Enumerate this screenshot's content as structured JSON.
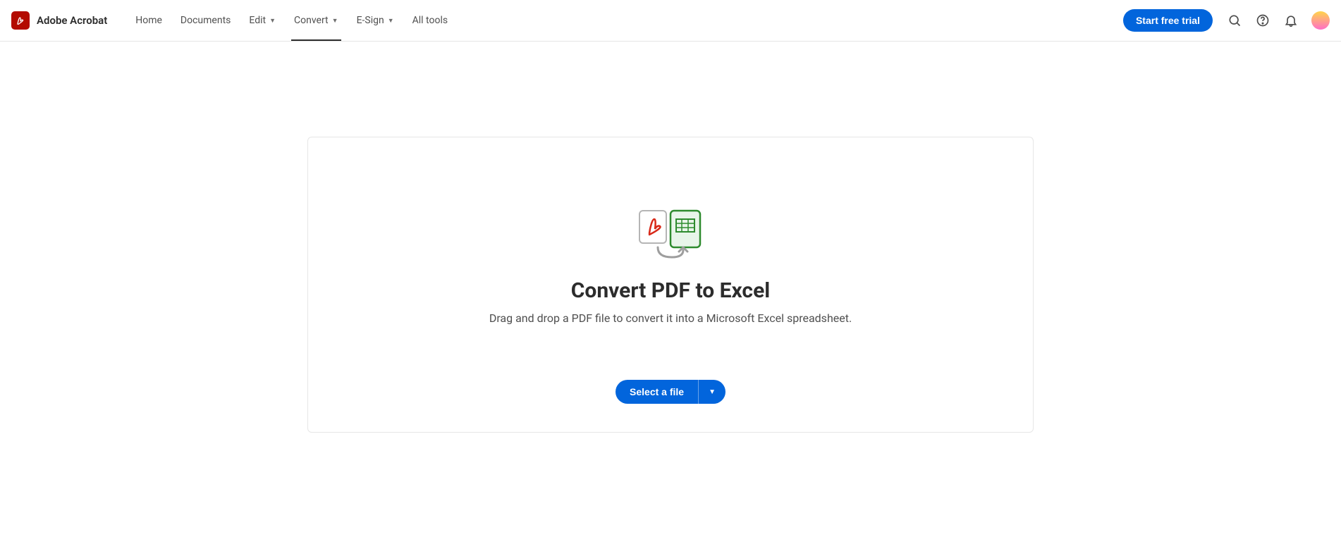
{
  "brand": {
    "name": "Adobe Acrobat"
  },
  "nav": {
    "home": "Home",
    "documents": "Documents",
    "edit": "Edit",
    "convert": "Convert",
    "esign": "E-Sign",
    "alltools": "All tools"
  },
  "cta": {
    "label": "Start free trial"
  },
  "page": {
    "title": "Convert PDF to Excel",
    "subtitle": "Drag and drop a PDF file to convert it into a Microsoft Excel spreadsheet.",
    "select_label": "Select a file"
  }
}
